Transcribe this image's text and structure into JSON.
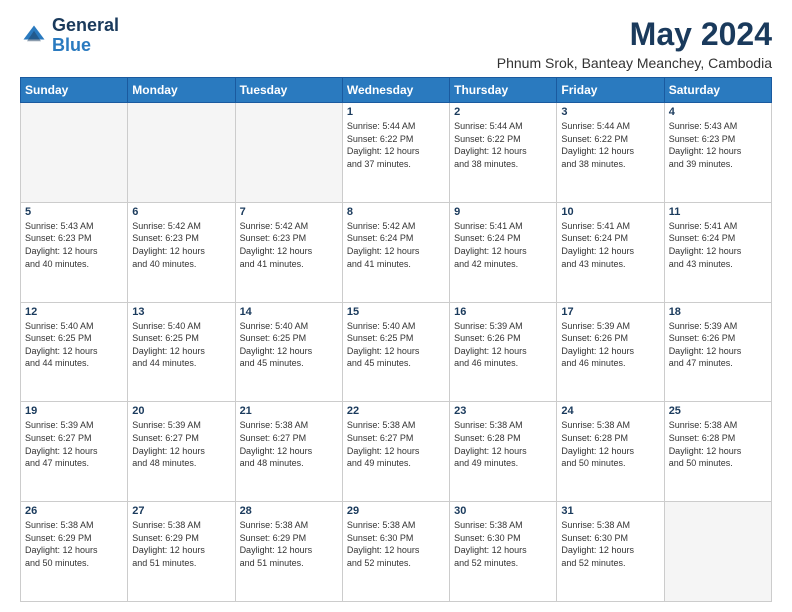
{
  "logo": {
    "line1": "General",
    "line2": "Blue"
  },
  "title": "May 2024",
  "subtitle": "Phnum Srok, Banteay Meanchey, Cambodia",
  "days_header": [
    "Sunday",
    "Monday",
    "Tuesday",
    "Wednesday",
    "Thursday",
    "Friday",
    "Saturday"
  ],
  "weeks": [
    [
      {
        "day": "",
        "info": ""
      },
      {
        "day": "",
        "info": ""
      },
      {
        "day": "",
        "info": ""
      },
      {
        "day": "1",
        "info": "Sunrise: 5:44 AM\nSunset: 6:22 PM\nDaylight: 12 hours\nand 37 minutes."
      },
      {
        "day": "2",
        "info": "Sunrise: 5:44 AM\nSunset: 6:22 PM\nDaylight: 12 hours\nand 38 minutes."
      },
      {
        "day": "3",
        "info": "Sunrise: 5:44 AM\nSunset: 6:22 PM\nDaylight: 12 hours\nand 38 minutes."
      },
      {
        "day": "4",
        "info": "Sunrise: 5:43 AM\nSunset: 6:23 PM\nDaylight: 12 hours\nand 39 minutes."
      }
    ],
    [
      {
        "day": "5",
        "info": "Sunrise: 5:43 AM\nSunset: 6:23 PM\nDaylight: 12 hours\nand 40 minutes."
      },
      {
        "day": "6",
        "info": "Sunrise: 5:42 AM\nSunset: 6:23 PM\nDaylight: 12 hours\nand 40 minutes."
      },
      {
        "day": "7",
        "info": "Sunrise: 5:42 AM\nSunset: 6:23 PM\nDaylight: 12 hours\nand 41 minutes."
      },
      {
        "day": "8",
        "info": "Sunrise: 5:42 AM\nSunset: 6:24 PM\nDaylight: 12 hours\nand 41 minutes."
      },
      {
        "day": "9",
        "info": "Sunrise: 5:41 AM\nSunset: 6:24 PM\nDaylight: 12 hours\nand 42 minutes."
      },
      {
        "day": "10",
        "info": "Sunrise: 5:41 AM\nSunset: 6:24 PM\nDaylight: 12 hours\nand 43 minutes."
      },
      {
        "day": "11",
        "info": "Sunrise: 5:41 AM\nSunset: 6:24 PM\nDaylight: 12 hours\nand 43 minutes."
      }
    ],
    [
      {
        "day": "12",
        "info": "Sunrise: 5:40 AM\nSunset: 6:25 PM\nDaylight: 12 hours\nand 44 minutes."
      },
      {
        "day": "13",
        "info": "Sunrise: 5:40 AM\nSunset: 6:25 PM\nDaylight: 12 hours\nand 44 minutes."
      },
      {
        "day": "14",
        "info": "Sunrise: 5:40 AM\nSunset: 6:25 PM\nDaylight: 12 hours\nand 45 minutes."
      },
      {
        "day": "15",
        "info": "Sunrise: 5:40 AM\nSunset: 6:25 PM\nDaylight: 12 hours\nand 45 minutes."
      },
      {
        "day": "16",
        "info": "Sunrise: 5:39 AM\nSunset: 6:26 PM\nDaylight: 12 hours\nand 46 minutes."
      },
      {
        "day": "17",
        "info": "Sunrise: 5:39 AM\nSunset: 6:26 PM\nDaylight: 12 hours\nand 46 minutes."
      },
      {
        "day": "18",
        "info": "Sunrise: 5:39 AM\nSunset: 6:26 PM\nDaylight: 12 hours\nand 47 minutes."
      }
    ],
    [
      {
        "day": "19",
        "info": "Sunrise: 5:39 AM\nSunset: 6:27 PM\nDaylight: 12 hours\nand 47 minutes."
      },
      {
        "day": "20",
        "info": "Sunrise: 5:39 AM\nSunset: 6:27 PM\nDaylight: 12 hours\nand 48 minutes."
      },
      {
        "day": "21",
        "info": "Sunrise: 5:38 AM\nSunset: 6:27 PM\nDaylight: 12 hours\nand 48 minutes."
      },
      {
        "day": "22",
        "info": "Sunrise: 5:38 AM\nSunset: 6:27 PM\nDaylight: 12 hours\nand 49 minutes."
      },
      {
        "day": "23",
        "info": "Sunrise: 5:38 AM\nSunset: 6:28 PM\nDaylight: 12 hours\nand 49 minutes."
      },
      {
        "day": "24",
        "info": "Sunrise: 5:38 AM\nSunset: 6:28 PM\nDaylight: 12 hours\nand 50 minutes."
      },
      {
        "day": "25",
        "info": "Sunrise: 5:38 AM\nSunset: 6:28 PM\nDaylight: 12 hours\nand 50 minutes."
      }
    ],
    [
      {
        "day": "26",
        "info": "Sunrise: 5:38 AM\nSunset: 6:29 PM\nDaylight: 12 hours\nand 50 minutes."
      },
      {
        "day": "27",
        "info": "Sunrise: 5:38 AM\nSunset: 6:29 PM\nDaylight: 12 hours\nand 51 minutes."
      },
      {
        "day": "28",
        "info": "Sunrise: 5:38 AM\nSunset: 6:29 PM\nDaylight: 12 hours\nand 51 minutes."
      },
      {
        "day": "29",
        "info": "Sunrise: 5:38 AM\nSunset: 6:30 PM\nDaylight: 12 hours\nand 52 minutes."
      },
      {
        "day": "30",
        "info": "Sunrise: 5:38 AM\nSunset: 6:30 PM\nDaylight: 12 hours\nand 52 minutes."
      },
      {
        "day": "31",
        "info": "Sunrise: 5:38 AM\nSunset: 6:30 PM\nDaylight: 12 hours\nand 52 minutes."
      },
      {
        "day": "",
        "info": ""
      }
    ]
  ]
}
